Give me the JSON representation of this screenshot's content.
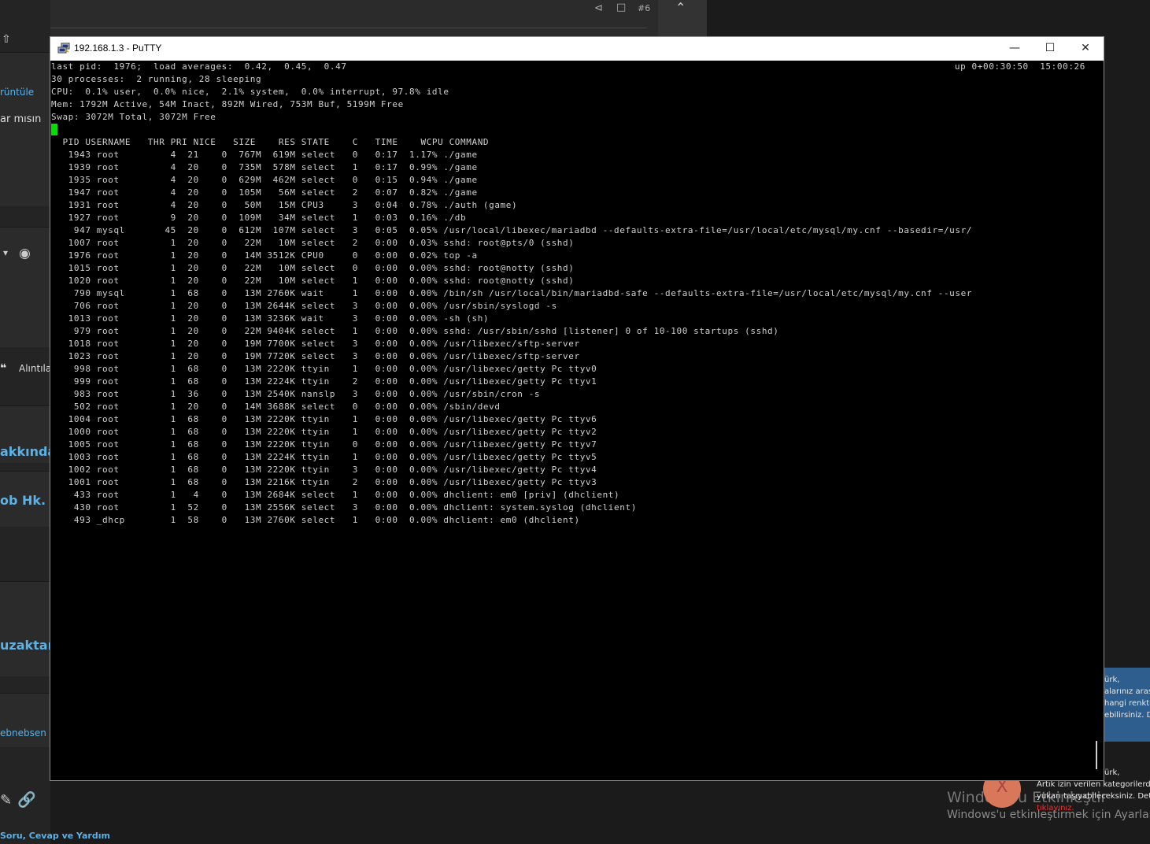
{
  "background": {
    "left_texts": [
      "rüntüle",
      "ar mısın",
      "Alıntıla",
      "akkında",
      "ob Hk.",
      "uzaktan",
      "ebnebsen"
    ],
    "top_counter": "#6",
    "notification_lines": [
      "ürk,",
      "alarınız arası",
      "hangi renkte",
      "ebilirsiniz. De"
    ],
    "notification_lines_2": [
      "ürk,",
      "Artık izin verilen kategorilerde",
      "yukarı taşıyabileceksiniz. Detay",
      "tıklayınız."
    ],
    "watermark_title": "Windows'u Etkinleştir",
    "watermark_sub": "Windows'u etkinleştirmek için Ayarlar'a",
    "breadcrumb": "Soru, Cevap ve Yardım",
    "close_x": "X"
  },
  "window": {
    "title": "192.168.1.3 - PuTTY",
    "minimize": "—",
    "maximize": "☐",
    "close": "✕"
  },
  "terminal": {
    "summary_line1": "last pid:  1976;  load averages:  0.42,  0.45,  0.47",
    "uptime": "up 0+00:30:50  15:00:26",
    "summary_line2": "30 processes:  2 running, 28 sleeping",
    "summary_line3": "CPU:  0.1% user,  0.0% nice,  2.1% system,  0.0% interrupt, 97.8% idle",
    "summary_line4": "Mem: 1792M Active, 54M Inact, 892M Wired, 753M Buf, 5199M Free",
    "summary_line5": "Swap: 3072M Total, 3072M Free",
    "columns": [
      "PID",
      "USERNAME",
      "THR",
      "PRI",
      "NICE",
      "SIZE",
      "RES",
      "STATE",
      "C",
      "TIME",
      "WCPU",
      "COMMAND"
    ],
    "processes": [
      [
        "1943",
        "root",
        "4",
        "21",
        "0",
        "767M",
        "619M",
        "select",
        "0",
        "0:17",
        "1.17%",
        "./game"
      ],
      [
        "1939",
        "root",
        "4",
        "20",
        "0",
        "735M",
        "578M",
        "select",
        "1",
        "0:17",
        "0.99%",
        "./game"
      ],
      [
        "1935",
        "root",
        "4",
        "20",
        "0",
        "629M",
        "462M",
        "select",
        "0",
        "0:15",
        "0.94%",
        "./game"
      ],
      [
        "1947",
        "root",
        "4",
        "20",
        "0",
        "105M",
        "56M",
        "select",
        "2",
        "0:07",
        "0.82%",
        "./game"
      ],
      [
        "1931",
        "root",
        "4",
        "20",
        "0",
        "50M",
        "15M",
        "CPU3",
        "3",
        "0:04",
        "0.78%",
        "./auth (game)"
      ],
      [
        "1927",
        "root",
        "9",
        "20",
        "0",
        "109M",
        "34M",
        "select",
        "1",
        "0:03",
        "0.16%",
        "./db"
      ],
      [
        "947",
        "mysql",
        "45",
        "20",
        "0",
        "612M",
        "107M",
        "select",
        "3",
        "0:05",
        "0.05%",
        "/usr/local/libexec/mariadbd --defaults-extra-file=/usr/local/etc/mysql/my.cnf --basedir=/usr/"
      ],
      [
        "1007",
        "root",
        "1",
        "20",
        "0",
        "22M",
        "10M",
        "select",
        "2",
        "0:00",
        "0.03%",
        "sshd: root@pts/0 (sshd)"
      ],
      [
        "1976",
        "root",
        "1",
        "20",
        "0",
        "14M",
        "3512K",
        "CPU0",
        "0",
        "0:00",
        "0.02%",
        "top -a"
      ],
      [
        "1015",
        "root",
        "1",
        "20",
        "0",
        "22M",
        "10M",
        "select",
        "0",
        "0:00",
        "0.00%",
        "sshd: root@notty (sshd)"
      ],
      [
        "1020",
        "root",
        "1",
        "20",
        "0",
        "22M",
        "10M",
        "select",
        "1",
        "0:00",
        "0.00%",
        "sshd: root@notty (sshd)"
      ],
      [
        "790",
        "mysql",
        "1",
        "68",
        "0",
        "13M",
        "2760K",
        "wait",
        "1",
        "0:00",
        "0.00%",
        "/bin/sh /usr/local/bin/mariadbd-safe --defaults-extra-file=/usr/local/etc/mysql/my.cnf --user"
      ],
      [
        "706",
        "root",
        "1",
        "20",
        "0",
        "13M",
        "2644K",
        "select",
        "3",
        "0:00",
        "0.00%",
        "/usr/sbin/syslogd -s"
      ],
      [
        "1013",
        "root",
        "1",
        "20",
        "0",
        "13M",
        "3236K",
        "wait",
        "3",
        "0:00",
        "0.00%",
        "-sh (sh)"
      ],
      [
        "979",
        "root",
        "1",
        "20",
        "0",
        "22M",
        "9404K",
        "select",
        "1",
        "0:00",
        "0.00%",
        "sshd: /usr/sbin/sshd [listener] 0 of 10-100 startups (sshd)"
      ],
      [
        "1018",
        "root",
        "1",
        "20",
        "0",
        "19M",
        "7700K",
        "select",
        "3",
        "0:00",
        "0.00%",
        "/usr/libexec/sftp-server"
      ],
      [
        "1023",
        "root",
        "1",
        "20",
        "0",
        "19M",
        "7720K",
        "select",
        "3",
        "0:00",
        "0.00%",
        "/usr/libexec/sftp-server"
      ],
      [
        "998",
        "root",
        "1",
        "68",
        "0",
        "13M",
        "2220K",
        "ttyin",
        "1",
        "0:00",
        "0.00%",
        "/usr/libexec/getty Pc ttyv0"
      ],
      [
        "999",
        "root",
        "1",
        "68",
        "0",
        "13M",
        "2224K",
        "ttyin",
        "2",
        "0:00",
        "0.00%",
        "/usr/libexec/getty Pc ttyv1"
      ],
      [
        "983",
        "root",
        "1",
        "36",
        "0",
        "13M",
        "2540K",
        "nanslp",
        "3",
        "0:00",
        "0.00%",
        "/usr/sbin/cron -s"
      ],
      [
        "502",
        "root",
        "1",
        "20",
        "0",
        "14M",
        "3688K",
        "select",
        "0",
        "0:00",
        "0.00%",
        "/sbin/devd"
      ],
      [
        "1004",
        "root",
        "1",
        "68",
        "0",
        "13M",
        "2220K",
        "ttyin",
        "1",
        "0:00",
        "0.00%",
        "/usr/libexec/getty Pc ttyv6"
      ],
      [
        "1000",
        "root",
        "1",
        "68",
        "0",
        "13M",
        "2220K",
        "ttyin",
        "1",
        "0:00",
        "0.00%",
        "/usr/libexec/getty Pc ttyv2"
      ],
      [
        "1005",
        "root",
        "1",
        "68",
        "0",
        "13M",
        "2220K",
        "ttyin",
        "0",
        "0:00",
        "0.00%",
        "/usr/libexec/getty Pc ttyv7"
      ],
      [
        "1003",
        "root",
        "1",
        "68",
        "0",
        "13M",
        "2224K",
        "ttyin",
        "1",
        "0:00",
        "0.00%",
        "/usr/libexec/getty Pc ttyv5"
      ],
      [
        "1002",
        "root",
        "1",
        "68",
        "0",
        "13M",
        "2220K",
        "ttyin",
        "3",
        "0:00",
        "0.00%",
        "/usr/libexec/getty Pc ttyv4"
      ],
      [
        "1001",
        "root",
        "1",
        "68",
        "0",
        "13M",
        "2216K",
        "ttyin",
        "2",
        "0:00",
        "0.00%",
        "/usr/libexec/getty Pc ttyv3"
      ],
      [
        "433",
        "root",
        "1",
        "4",
        "0",
        "13M",
        "2684K",
        "select",
        "1",
        "0:00",
        "0.00%",
        "dhclient: em0 [priv] (dhclient)"
      ],
      [
        "430",
        "root",
        "1",
        "52",
        "0",
        "13M",
        "2556K",
        "select",
        "3",
        "0:00",
        "0.00%",
        "dhclient: system.syslog (dhclient)"
      ],
      [
        "493",
        "_dhcp",
        "1",
        "58",
        "0",
        "13M",
        "2760K",
        "select",
        "1",
        "0:00",
        "0.00%",
        "dhclient: em0 (dhclient)"
      ]
    ]
  }
}
